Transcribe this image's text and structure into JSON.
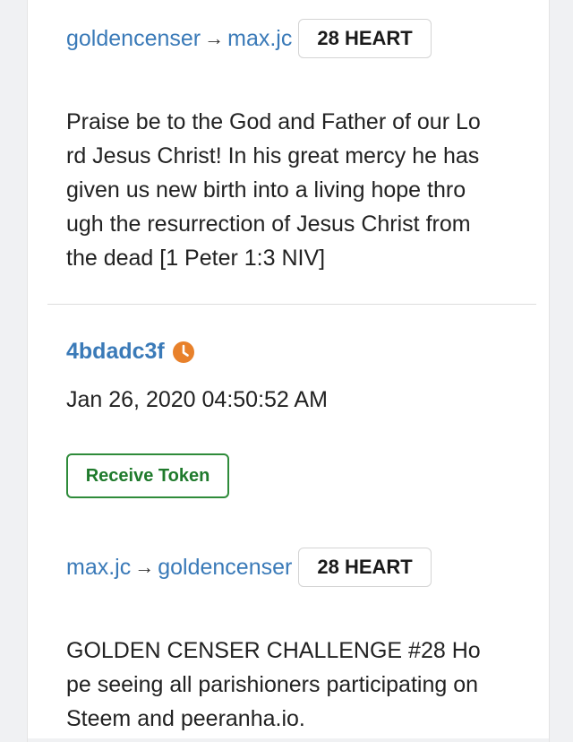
{
  "transfers": [
    {
      "from": "goldencenser",
      "arrow": "→",
      "to": "max.jc",
      "amount": "28 HEART",
      "memo_lines": [
        "Praise be to the God and Father of our Lo",
        "rd Jesus Christ! In his great mercy he has",
        "given us new birth into a living hope thro",
        "ugh the resurrection of Jesus Christ from",
        "the dead [1 Peter 1:3 NIV]"
      ]
    },
    {
      "tx_id": "4bdadc3f",
      "status_icon": "clock-icon",
      "status_color": "#e8812b",
      "timestamp": "Jan 26, 2020 04:50:52 AM",
      "action_label": "Receive Token",
      "from": "max.jc",
      "arrow": "→",
      "to": "goldencenser",
      "amount": "28 HEART",
      "memo_lines": [
        "GOLDEN CENSER CHALLENGE #28 Ho",
        "pe seeing all parishioners participating on",
        "Steem and peeranha.io."
      ]
    }
  ],
  "colors": {
    "link": "#3a7ab8",
    "accent_green": "#2e8b3a",
    "pending_orange": "#e8812b"
  }
}
